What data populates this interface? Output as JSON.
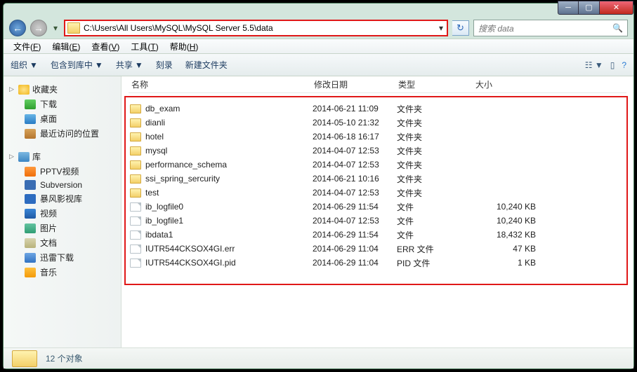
{
  "window": {
    "address": "C:\\Users\\All Users\\MySQL\\MySQL Server 5.5\\data",
    "search_placeholder": "搜索 data"
  },
  "menubar": [
    {
      "label": "文件",
      "key": "F"
    },
    {
      "label": "编辑",
      "key": "E"
    },
    {
      "label": "查看",
      "key": "V"
    },
    {
      "label": "工具",
      "key": "T"
    },
    {
      "label": "帮助",
      "key": "H"
    }
  ],
  "toolbar": {
    "organize": "组织",
    "include": "包含到库中",
    "share": "共享",
    "burn": "刻录",
    "newfolder": "新建文件夹"
  },
  "sidebar": {
    "favorites": {
      "label": "收藏夹",
      "items": [
        {
          "label": "下载",
          "icon": "dl"
        },
        {
          "label": "桌面",
          "icon": "desk"
        },
        {
          "label": "最近访问的位置",
          "icon": "rec"
        }
      ]
    },
    "libraries": {
      "label": "库",
      "items": [
        {
          "label": "PPTV视频",
          "icon": "pptv"
        },
        {
          "label": "Subversion",
          "icon": "svn"
        },
        {
          "label": "暴风影视库",
          "icon": "bfy"
        },
        {
          "label": "视频",
          "icon": "vid"
        },
        {
          "label": "图片",
          "icon": "pic"
        },
        {
          "label": "文档",
          "icon": "doc"
        },
        {
          "label": "迅雷下载",
          "icon": "xdl"
        },
        {
          "label": "音乐",
          "icon": "mus"
        }
      ]
    }
  },
  "columns": {
    "name": "名称",
    "date": "修改日期",
    "type": "类型",
    "size": "大小"
  },
  "files": [
    {
      "name": "db_exam",
      "date": "2014-06-21 11:09",
      "type": "文件夹",
      "size": "",
      "kind": "fold"
    },
    {
      "name": "dianli",
      "date": "2014-05-10 21:32",
      "type": "文件夹",
      "size": "",
      "kind": "fold"
    },
    {
      "name": "hotel",
      "date": "2014-06-18 16:17",
      "type": "文件夹",
      "size": "",
      "kind": "fold"
    },
    {
      "name": "mysql",
      "date": "2014-04-07 12:53",
      "type": "文件夹",
      "size": "",
      "kind": "fold"
    },
    {
      "name": "performance_schema",
      "date": "2014-04-07 12:53",
      "type": "文件夹",
      "size": "",
      "kind": "fold"
    },
    {
      "name": "ssi_spring_sercurity",
      "date": "2014-06-21 10:16",
      "type": "文件夹",
      "size": "",
      "kind": "fold"
    },
    {
      "name": "test",
      "date": "2014-04-07 12:53",
      "type": "文件夹",
      "size": "",
      "kind": "fold"
    },
    {
      "name": "ib_logfile0",
      "date": "2014-06-29 11:54",
      "type": "文件",
      "size": "10,240 KB",
      "kind": "file"
    },
    {
      "name": "ib_logfile1",
      "date": "2014-04-07 12:53",
      "type": "文件",
      "size": "10,240 KB",
      "kind": "file"
    },
    {
      "name": "ibdata1",
      "date": "2014-06-29 11:54",
      "type": "文件",
      "size": "18,432 KB",
      "kind": "file"
    },
    {
      "name": "IUTR544CKSOX4GI.err",
      "date": "2014-06-29 11:04",
      "type": "ERR 文件",
      "size": "47 KB",
      "kind": "file"
    },
    {
      "name": "IUTR544CKSOX4GI.pid",
      "date": "2014-06-29 11:04",
      "type": "PID 文件",
      "size": "1 KB",
      "kind": "file"
    }
  ],
  "status": {
    "count": "12 个对象"
  }
}
